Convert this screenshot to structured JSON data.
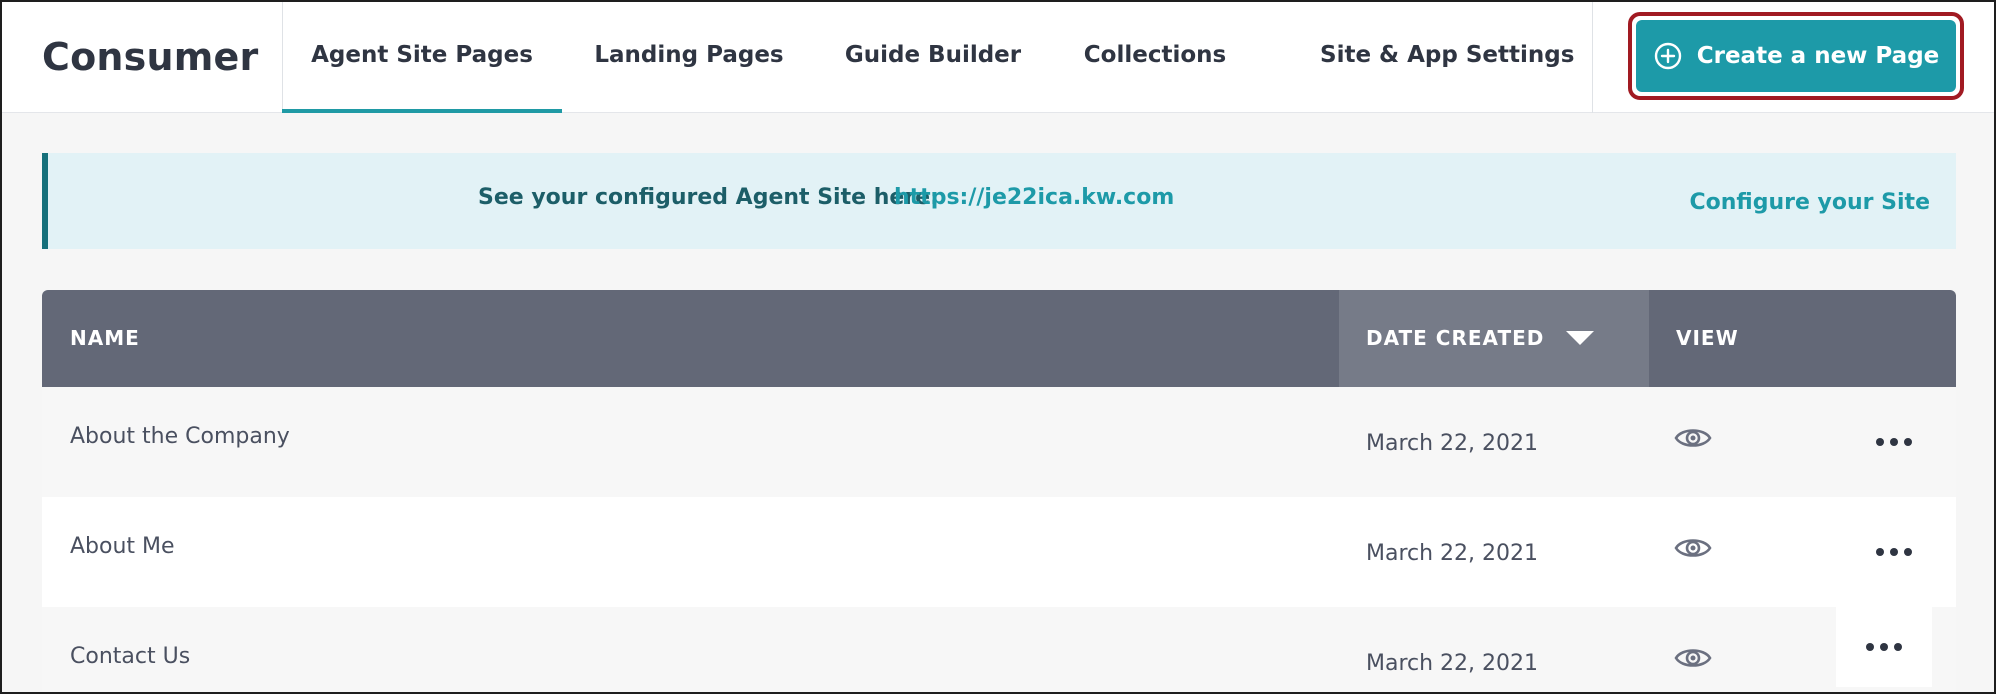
{
  "header": {
    "brand": "Consumer",
    "tabs": [
      {
        "label": "Agent Site Pages",
        "active": true
      },
      {
        "label": "Landing Pages",
        "active": false
      },
      {
        "label": "Guide Builder",
        "active": false
      },
      {
        "label": "Collections",
        "active": false
      },
      {
        "label": "Site & App Settings",
        "active": false
      }
    ],
    "cta_label": "Create a new Page",
    "cta_icon": "plus-circle-icon"
  },
  "banner": {
    "label": "See your configured Agent Site here:",
    "link": "https://je22ica.kw.com",
    "configure": "Configure your Site"
  },
  "table": {
    "columns": {
      "name": "NAME",
      "date_created": "DATE CREATED",
      "view": "VIEW"
    },
    "sort_icon": "caret-down-icon",
    "rows": [
      {
        "name": "About the Company",
        "date": "March 22, 2021"
      },
      {
        "name": "About Me",
        "date": "March 22, 2021"
      },
      {
        "name": "Contact Us",
        "date": "March 22, 2021"
      }
    ]
  },
  "colors": {
    "accent": "#1d9aa8",
    "highlight_outline": "#a11a22",
    "table_header": "#636877",
    "banner_bg": "#e2f2f6"
  }
}
